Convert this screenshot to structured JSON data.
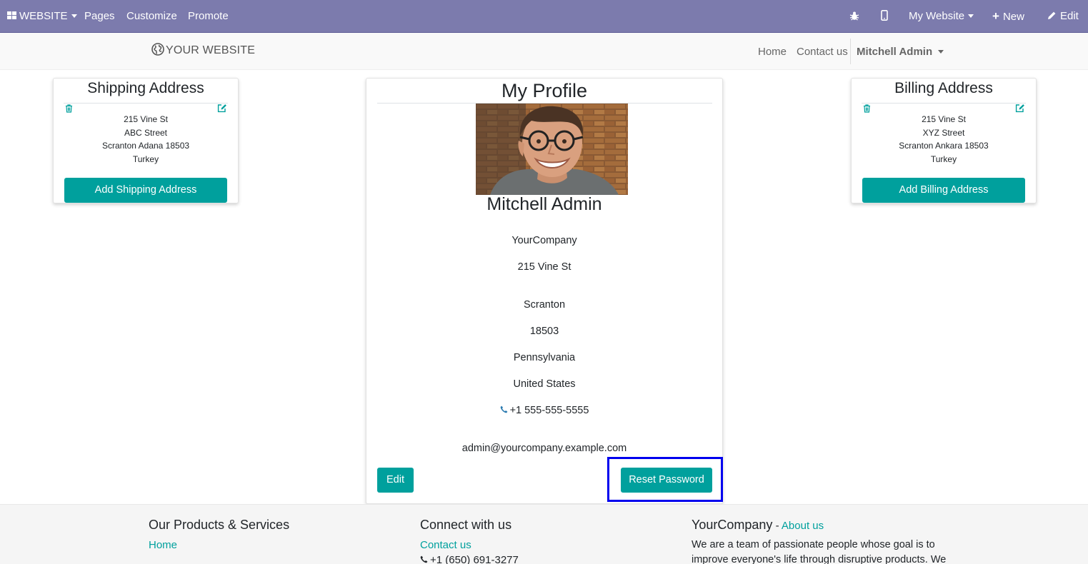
{
  "adminbar": {
    "website_menu": "WEBSITE",
    "menu_items": [
      "Pages",
      "Customize",
      "Promote"
    ],
    "site_selector": "My Website",
    "new_label": "New",
    "edit_label": "Edit"
  },
  "header": {
    "logo_text": "YOUR WEBSITE",
    "nav": [
      "Home",
      "Contact us"
    ],
    "user_menu": "Mitchell Admin"
  },
  "shipping": {
    "title": "Shipping Address",
    "lines": [
      "215 Vine St",
      "ABC Street",
      "Scranton Adana 18503",
      "Turkey"
    ],
    "button": "Add Shipping Address"
  },
  "billing": {
    "title": "Billing Address",
    "lines": [
      "215 Vine St",
      "XYZ Street",
      "Scranton Ankara 18503",
      "Turkey"
    ],
    "button": "Add Billing Address"
  },
  "profile": {
    "title": "My Profile",
    "name": "Mitchell Admin",
    "company": "YourCompany",
    "street": "215 Vine St",
    "city": "Scranton",
    "zip": "18503",
    "state": "Pennsylvania",
    "country": "United States",
    "phone": "+1 555-555-5555",
    "email": "admin@yourcompany.example.com",
    "edit_button": "Edit",
    "reset_button": "Reset Password"
  },
  "footer": {
    "col1_title": "Our Products & Services",
    "col1_link": "Home",
    "col2_title": "Connect with us",
    "col2_link": "Contact us",
    "col2_phone": "+1 (650) 691-3277",
    "col3_title": "YourCompany",
    "col3_sep": " - ",
    "col3_link": "About us",
    "col3_text_1": "We are a team of passionate people whose goal is to",
    "col3_text_2": "improve everyone's life through disruptive products. We"
  },
  "colors": {
    "adminbar_bg": "#7c7bad",
    "primary": "#00a09d",
    "highlight": "#0000ee"
  }
}
